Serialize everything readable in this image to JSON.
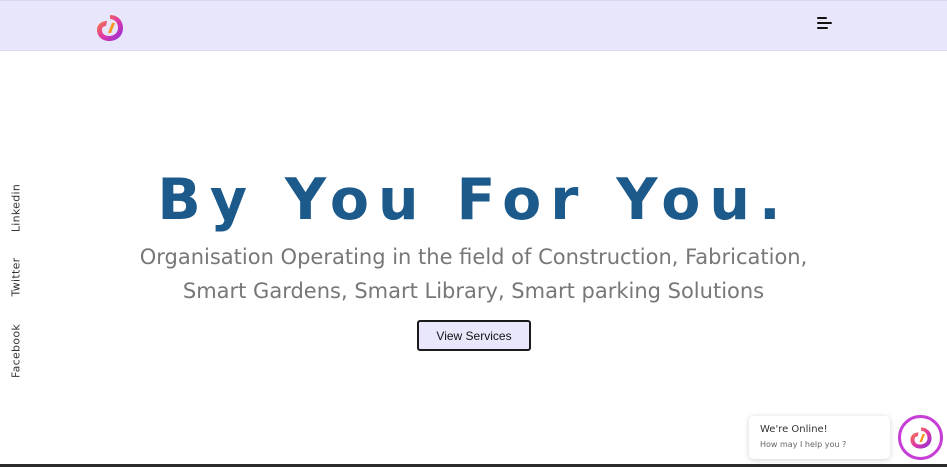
{
  "nav": {
    "logo_icon": "brand-swirl-logo-icon",
    "menu_icon": "hamburger-menu-icon"
  },
  "social": {
    "linkedin": "Linkedin",
    "twitter": "Twitter",
    "facebook": "Facebook"
  },
  "hero": {
    "title": "By You For You.",
    "subtitle_line1": "Organisation Operating in the field of Construction, Fabrication,",
    "subtitle_line2": "Smart Gardens, Smart Library, Smart parking Solutions",
    "cta_label": "View Services"
  },
  "chat": {
    "status": "We're Online!",
    "prompt": "How may I help you ?",
    "launcher_icon": "brand-swirl-logo-icon"
  },
  "colors": {
    "nav_bg": "#e7e6fb",
    "title": "#1c5a8c",
    "subtitle": "#777777",
    "button_bg": "#e9e7fc",
    "accent_purple": "#c73fd6",
    "accent_orange": "#f7941d"
  }
}
